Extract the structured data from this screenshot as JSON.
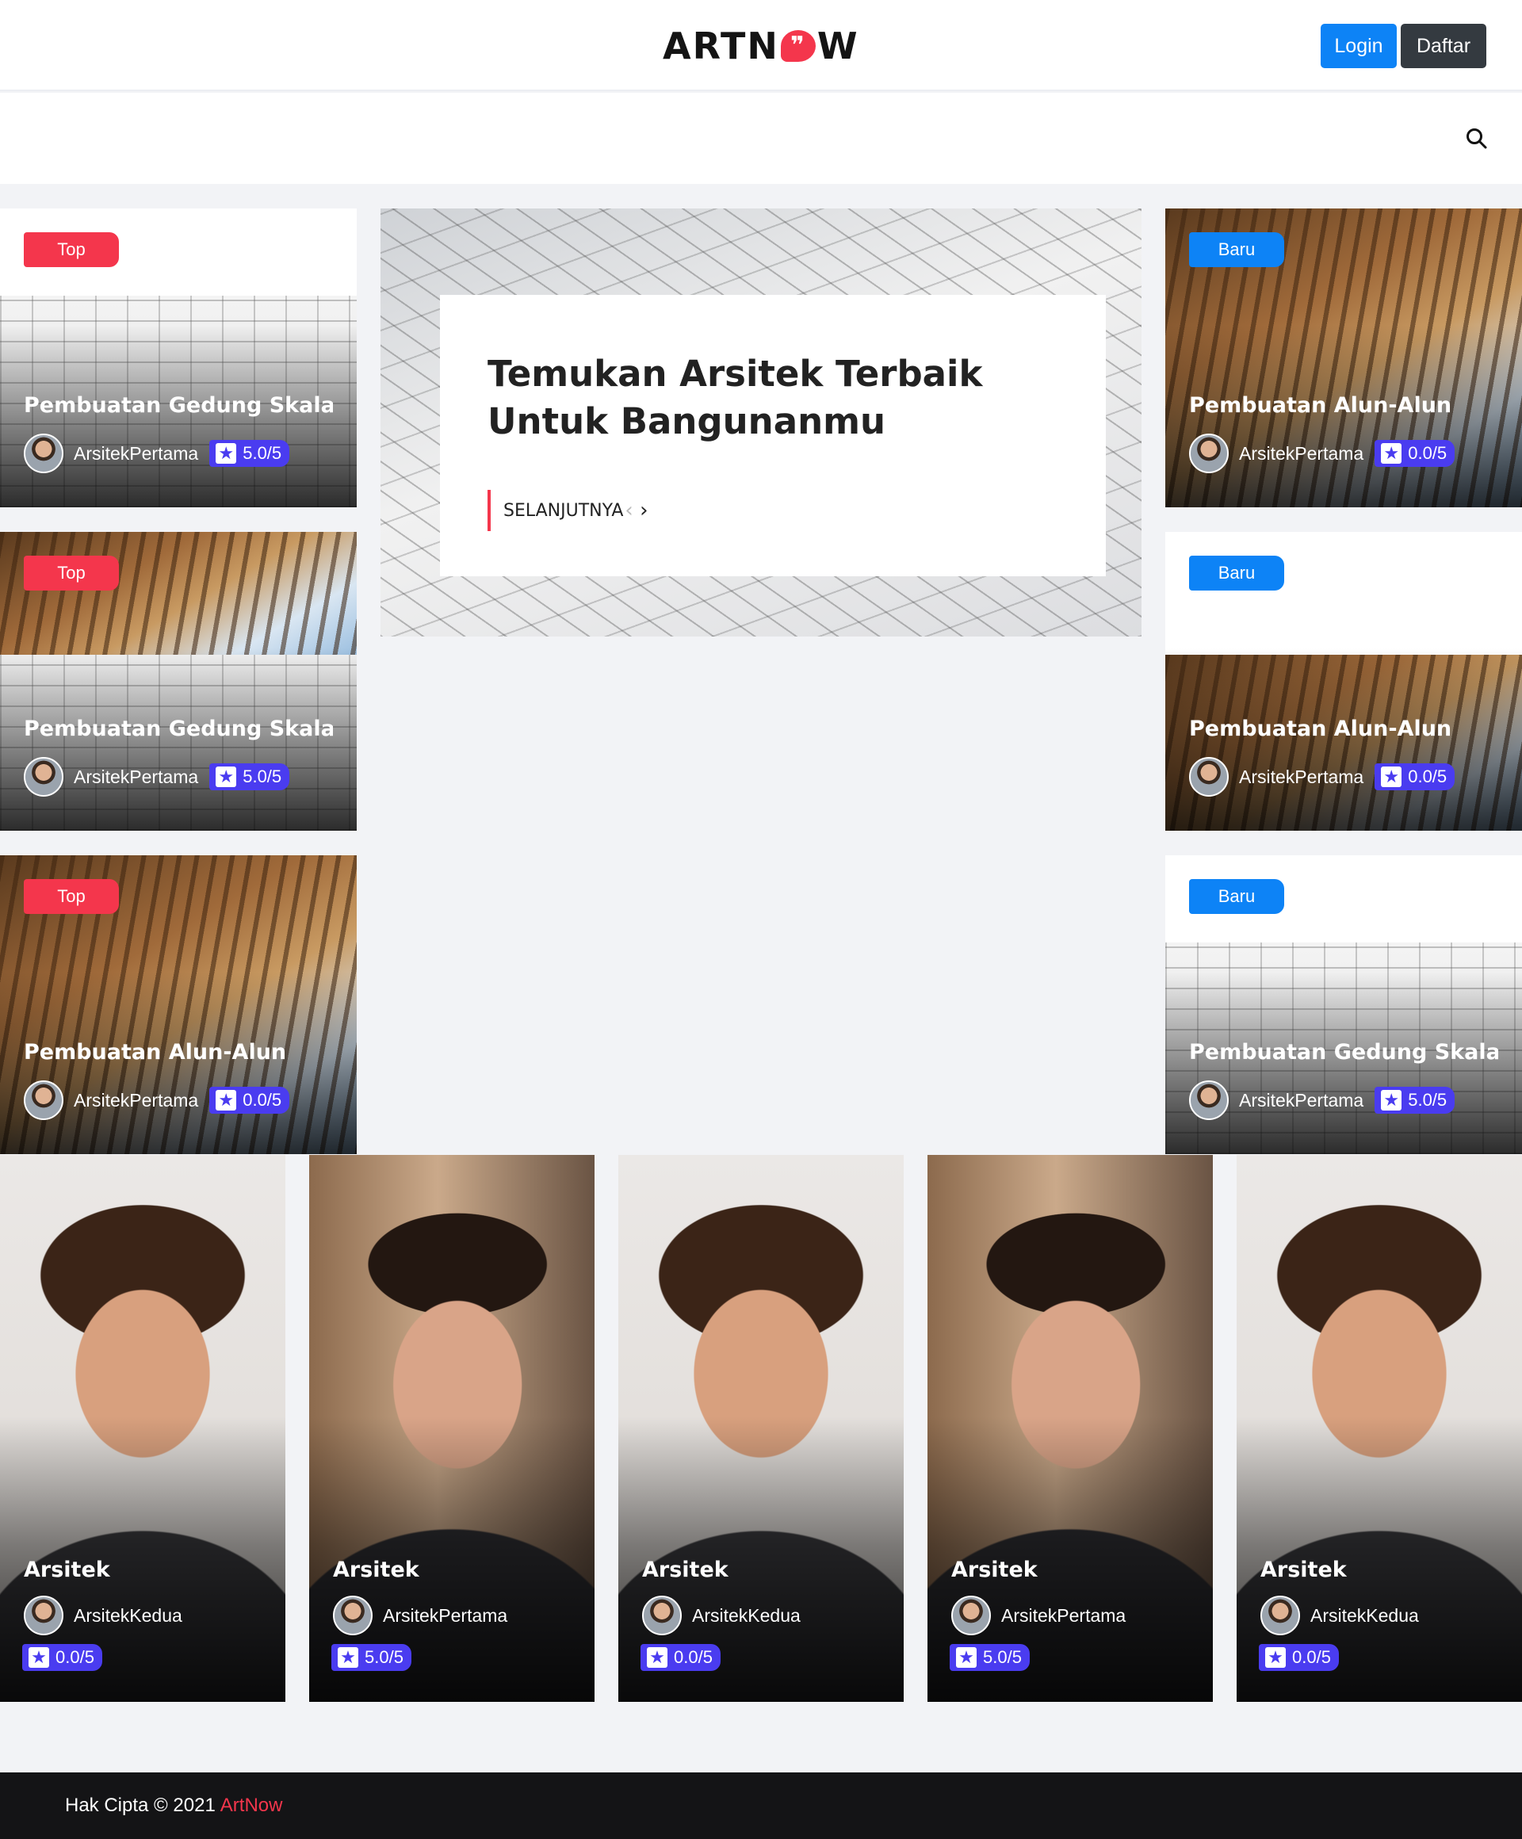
{
  "header": {
    "logo_text_left": "ARTN",
    "logo_quote": "❞",
    "logo_text_right": "W",
    "login_label": "Login",
    "daftar_label": "Daftar"
  },
  "hero": {
    "title": "Temukan Arsitek Terbaik Untuk Bangunanmu",
    "more_label": "SELANJUTNYA",
    "prev_icon": "‹",
    "next_icon": "›"
  },
  "left_cards": [
    {
      "badge": "Top",
      "title": "Pembuatan Gedung Skala Menengah",
      "author": "ArsitekPertama",
      "rating": "5.0/5",
      "image": "sketch"
    },
    {
      "badge": "Top",
      "title": "Pembuatan Gedung Skala Menengah",
      "author": "ArsitekPertama",
      "rating": "5.0/5",
      "image": "sketch"
    },
    {
      "badge": "Top",
      "title": "Pembuatan Alun-Alun",
      "author": "ArsitekPertama",
      "rating": "0.0/5",
      "image": "wood"
    }
  ],
  "right_cards": [
    {
      "badge": "Baru",
      "title": "Pembuatan Alun-Alun",
      "author": "ArsitekPertama",
      "rating": "0.0/5",
      "image": "wood"
    },
    {
      "badge": "Baru",
      "title": "Pembuatan Alun-Alun",
      "author": "ArsitekPertama",
      "rating": "0.0/5",
      "image": "wood"
    },
    {
      "badge": "Baru",
      "title": "Pembuatan Gedung Skala Menengah",
      "author": "ArsitekPertama",
      "rating": "5.0/5",
      "image": "sketch"
    }
  ],
  "architects": [
    {
      "title": "Arsitek",
      "name": "ArsitekKedua",
      "rating": "0.0/5",
      "photo": "a"
    },
    {
      "title": "Arsitek",
      "name": "ArsitekPertama",
      "rating": "5.0/5",
      "photo": "b"
    },
    {
      "title": "Arsitek",
      "name": "ArsitekKedua",
      "rating": "0.0/5",
      "photo": "a"
    },
    {
      "title": "Arsitek",
      "name": "ArsitekPertama",
      "rating": "5.0/5",
      "photo": "b"
    },
    {
      "title": "Arsitek",
      "name": "ArsitekKedua",
      "rating": "0.0/5",
      "photo": "a"
    }
  ],
  "footer": {
    "copyright": "Hak Cipta © 2021",
    "brand": "ArtNow"
  },
  "icons": {
    "search": "search-icon",
    "star": "star-icon"
  },
  "colors": {
    "accent_red": "#f4364c",
    "accent_blue": "#0d83f6",
    "rating_purple": "#4a3cf0",
    "dark": "#343a40"
  }
}
